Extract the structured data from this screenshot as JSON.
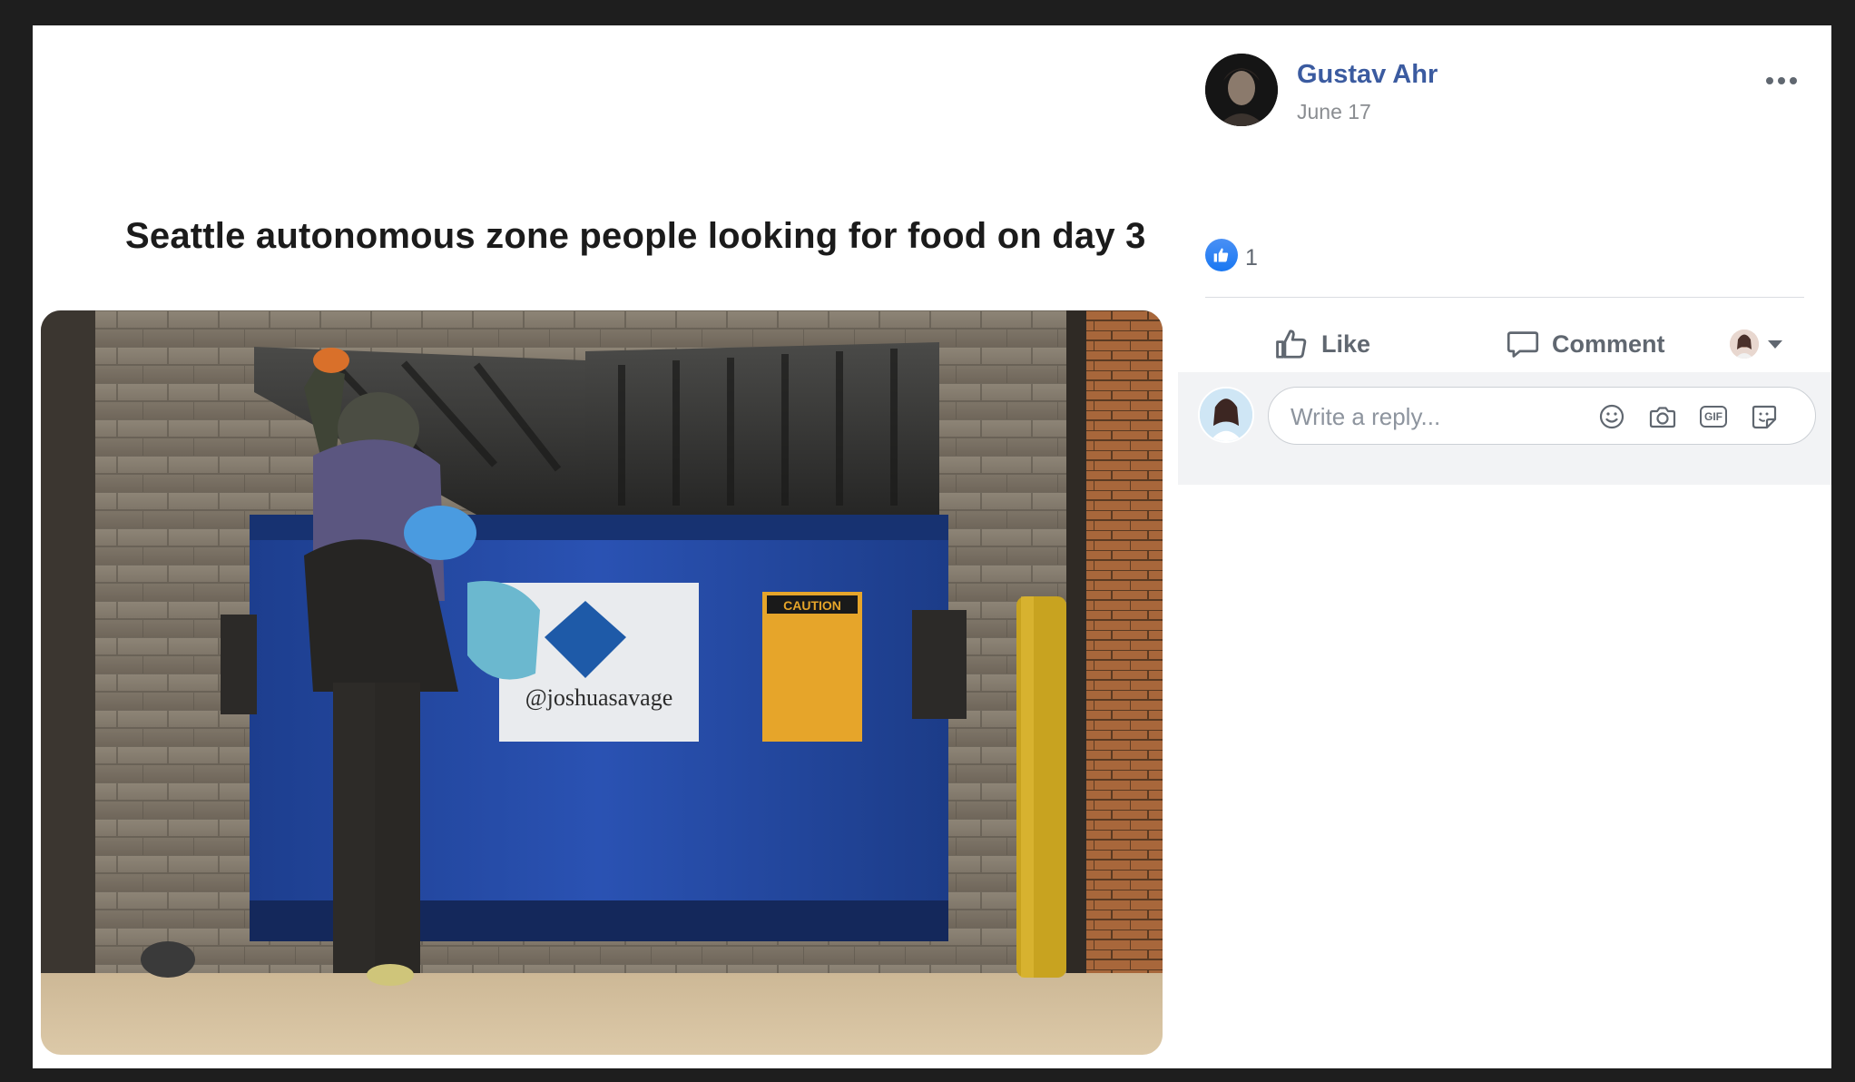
{
  "post": {
    "caption": "Seattle autonomous zone people looking for food on day 3",
    "image_watermark": "@joshuasavage",
    "sign_text": "CAUTION"
  },
  "author": {
    "name": "Gustav Ahr",
    "date": "June 17"
  },
  "reactions": {
    "icon": "like-thumb-icon",
    "count": "1"
  },
  "actions": {
    "like_label": "Like",
    "comment_label": "Comment"
  },
  "reply": {
    "placeholder": "Write a reply...",
    "tools": [
      "emoji-icon",
      "camera-icon",
      "gif-icon",
      "sticker-icon"
    ]
  },
  "colors": {
    "author_link": "#3b5ba0",
    "secondary_text": "#8a8d91",
    "like_blue": "#1877f2",
    "reply_area_bg": "#f2f3f5"
  }
}
